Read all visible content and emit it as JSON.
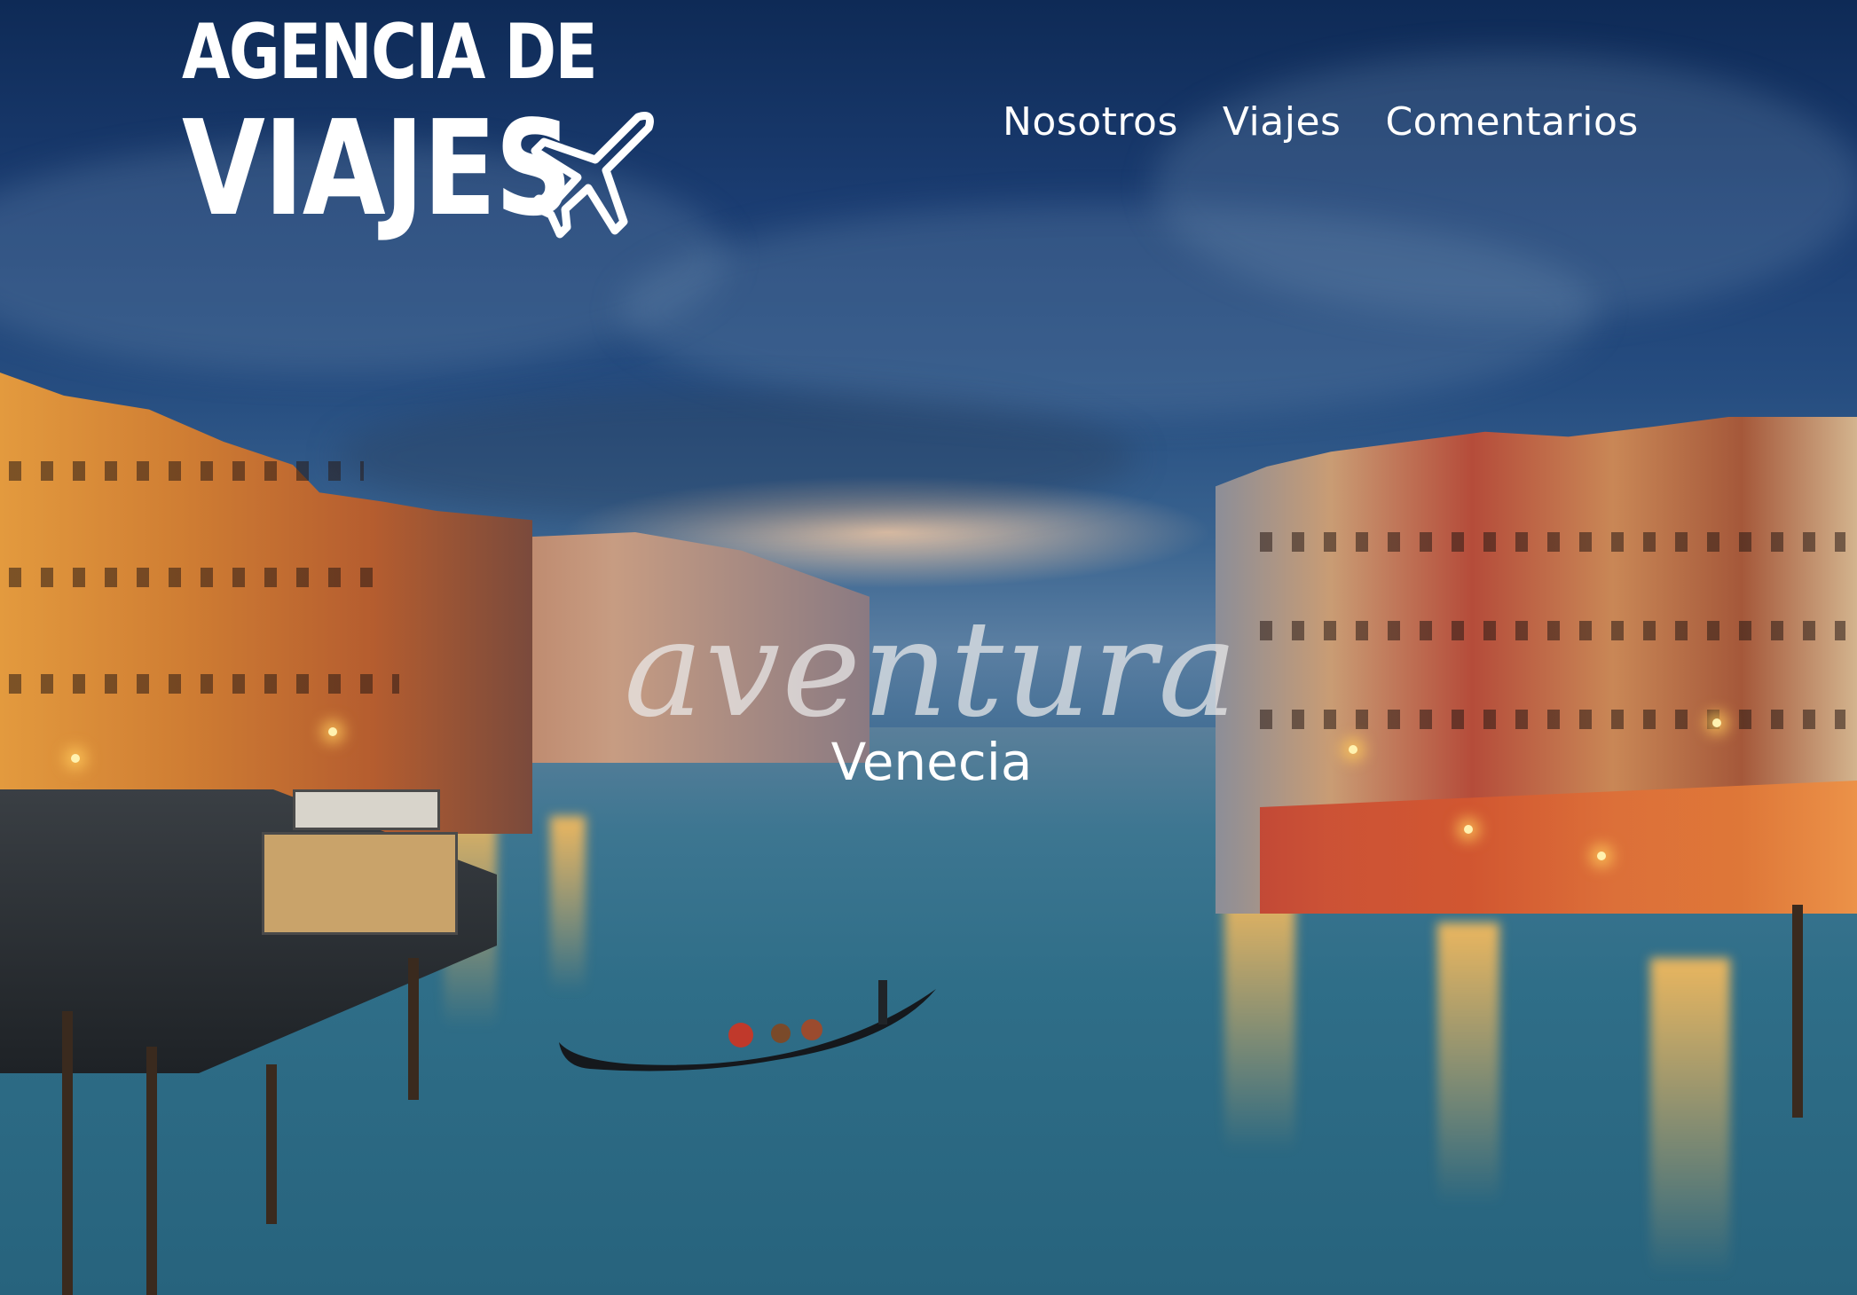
{
  "logo": {
    "line1": "AGENCIA DE",
    "line2": "VIAJES",
    "icon": "airplane-icon"
  },
  "nav": {
    "items": [
      "Nosotros",
      "Viajes",
      "Comentarios"
    ]
  },
  "hero": {
    "headline": "aventura",
    "subline": "Venecia"
  },
  "colors": {
    "text": "#ffffff",
    "headline": "#ebebeb",
    "sky": "#1b3d72",
    "water": "#2f6e88"
  }
}
